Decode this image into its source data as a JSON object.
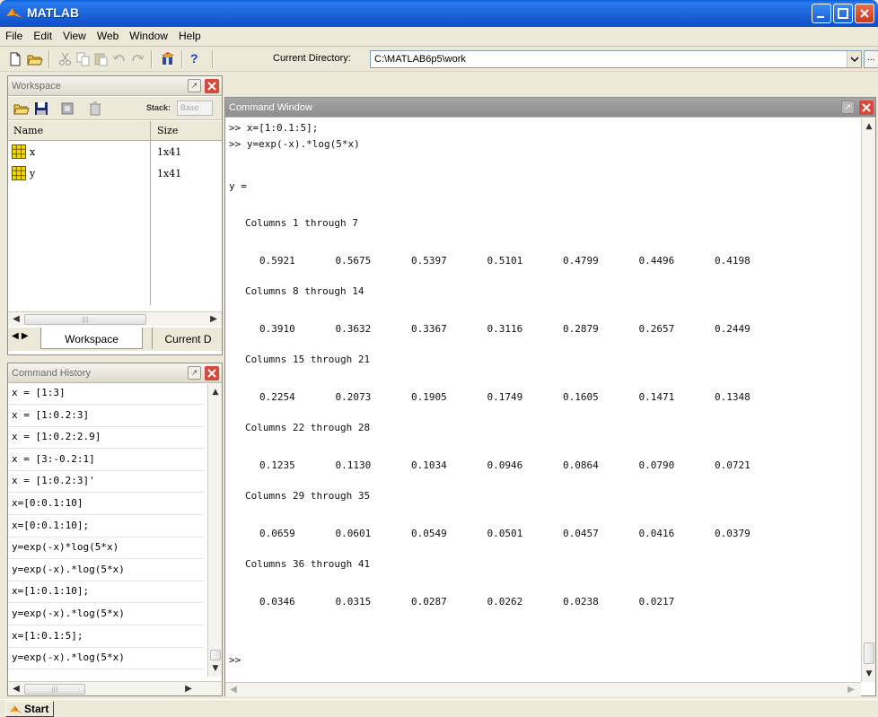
{
  "window": {
    "title": "MATLAB",
    "colors": {
      "titlebar": "#1b62d8",
      "close": "#d54a3c",
      "matrix_icon": "#f5d800"
    }
  },
  "menu": [
    "File",
    "Edit",
    "View",
    "Web",
    "Window",
    "Help"
  ],
  "toolbar": {
    "icons": [
      "new-file-icon",
      "open-folder-icon",
      "cut-icon",
      "copy-icon",
      "paste-icon",
      "undo-icon",
      "redo-icon",
      "simulink-icon",
      "help-icon"
    ],
    "help_glyph": "?",
    "current_directory_label": "Current Directory:",
    "current_directory_value": "C:\\MATLAB6p5\\work",
    "browse_glyph": "..."
  },
  "workspace": {
    "title": "Workspace",
    "stack_label": "Stack:",
    "stack_value": "Base",
    "columns": [
      "Name",
      "Size"
    ],
    "rows": [
      {
        "name": "x",
        "size": "1x41"
      },
      {
        "name": "y",
        "size": "1x41"
      }
    ],
    "tabs": [
      "Workspace",
      "Current D"
    ]
  },
  "history": {
    "title": "Command History",
    "lines": [
      "x = [1:3]",
      "x = [1:0.2:3]",
      "x = [1:0.2:2.9]",
      "x = [3:-0.2:1]",
      "x = [1:0.2:3]'",
      "x=[0:0.1:10]",
      "x=[0:0.1:10];",
      "y=exp(-x)*log(5*x)",
      "y=exp(-x).*log(5*x)",
      "x=[1:0.1:10];",
      "y=exp(-x).*log(5*x)",
      "x=[1:0.1:5];",
      "y=exp(-x).*log(5*x)"
    ]
  },
  "command_window": {
    "title": "Command Window",
    "commands": [
      ">> x=[1:0.1:5];",
      ">> y=exp(-x).*log(5*x)"
    ],
    "var_label": "y =",
    "blocks": [
      {
        "header": "Columns 1 through 7",
        "values": [
          "0.5921",
          "0.5675",
          "0.5397",
          "0.5101",
          "0.4799",
          "0.4496",
          "0.4198"
        ]
      },
      {
        "header": "Columns 8 through 14",
        "values": [
          "0.3910",
          "0.3632",
          "0.3367",
          "0.3116",
          "0.2879",
          "0.2657",
          "0.2449"
        ]
      },
      {
        "header": "Columns 15 through 21",
        "values": [
          "0.2254",
          "0.2073",
          "0.1905",
          "0.1749",
          "0.1605",
          "0.1471",
          "0.1348"
        ]
      },
      {
        "header": "Columns 22 through 28",
        "values": [
          "0.1235",
          "0.1130",
          "0.1034",
          "0.0946",
          "0.0864",
          "0.0790",
          "0.0721"
        ]
      },
      {
        "header": "Columns 29 through 35",
        "values": [
          "0.0659",
          "0.0601",
          "0.0549",
          "0.0501",
          "0.0457",
          "0.0416",
          "0.0379"
        ]
      },
      {
        "header": "Columns 36 through 41",
        "values": [
          "0.0346",
          "0.0315",
          "0.0287",
          "0.0262",
          "0.0238",
          "0.0217"
        ]
      }
    ],
    "prompt": ">>"
  },
  "taskbar": {
    "start_label": "Start"
  }
}
